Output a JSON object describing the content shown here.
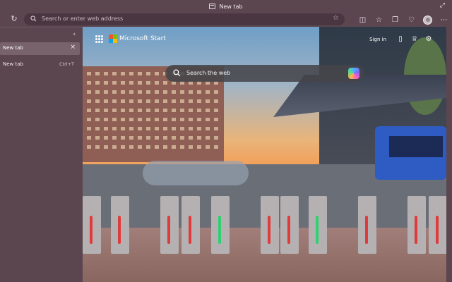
{
  "window": {
    "tab_title": "New tab"
  },
  "toolbar": {
    "address_placeholder": "Search or enter web address",
    "icons": [
      "refresh-icon",
      "search-icon",
      "favorite-star-icon",
      "split-screen-icon",
      "favorites-icon",
      "collections-icon",
      "browser-essentials-icon",
      "profile-avatar",
      "more-icon"
    ]
  },
  "sidebar": {
    "tabs": [
      {
        "label": "New tab"
      }
    ],
    "new_tab_label": "New tab",
    "new_tab_shortcut": "Ctrl+T"
  },
  "start_page": {
    "brand": "Microsoft Start",
    "sign_in": "Sign in",
    "search_placeholder": "Search the web"
  },
  "colors": {
    "chrome": "#5b4650",
    "address_bar": "#4a3640",
    "selected_tab": "#78636c"
  }
}
